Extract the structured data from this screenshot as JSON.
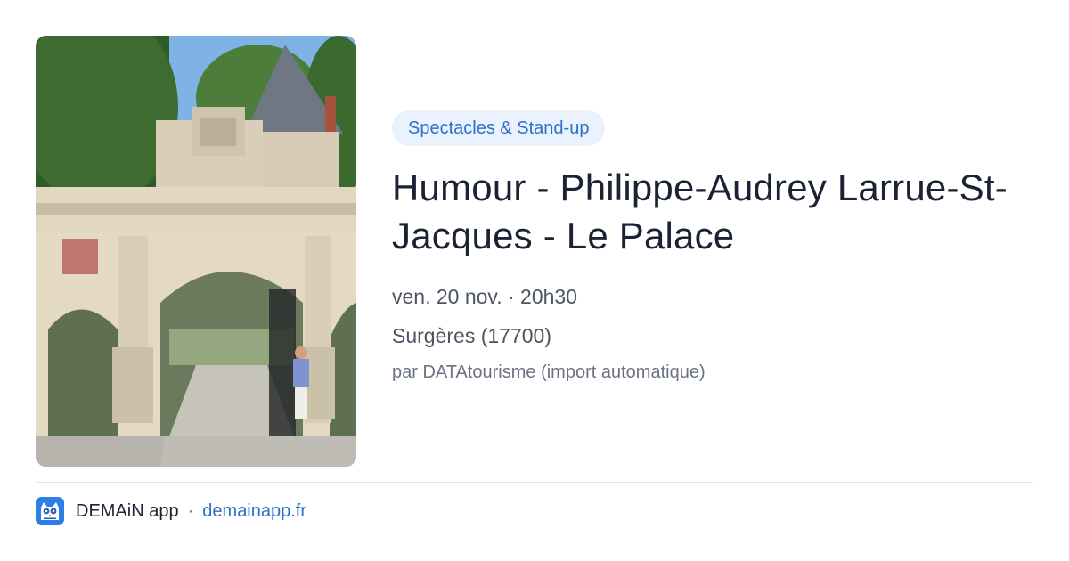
{
  "event": {
    "category": "Spectacles & Stand-up",
    "title": "Humour - Philippe-Audrey Larrue-St-Jacques - Le Palace",
    "datetime": "ven. 20 nov. · 20h30",
    "location": "Surgères (17700)",
    "source": "par DATAtourisme (import automatique)"
  },
  "footer": {
    "app_name": "DEMAiN app",
    "separator": "·",
    "domain": "demainapp.fr"
  },
  "icons": {
    "logo": "owl-icon"
  },
  "colors": {
    "accent": "#2f6fc8",
    "category_background": "#eaf2fd",
    "logo_background": "#2f7ee8"
  }
}
